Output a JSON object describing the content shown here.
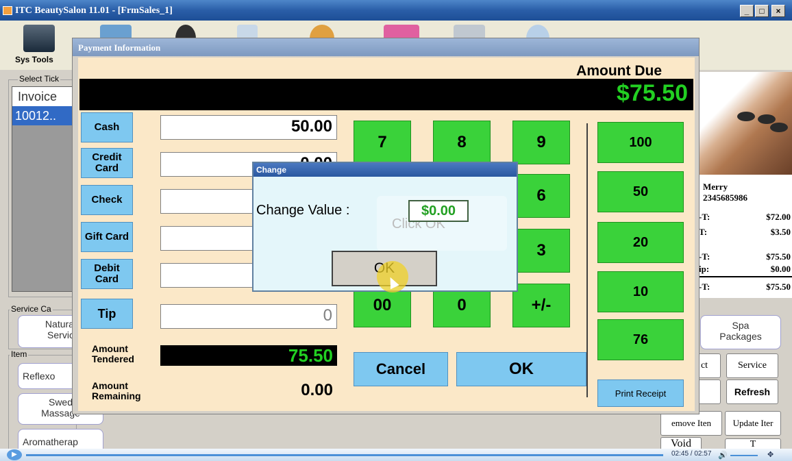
{
  "window": {
    "title": "ITC BeautySalon 11.01 - [FrmSales_1]",
    "buttons": [
      "_",
      "□",
      "×"
    ]
  },
  "toolbar": {
    "sys_tools_label": "Sys Tools"
  },
  "left_panel": {
    "select_ticket_label": "Select Tick",
    "invoice_header": "Invoice",
    "invoice_row": "10012..",
    "service_category_label": "Service Ca",
    "service_category_button": "Natural\nServic",
    "item_label": "Item",
    "items": [
      "Reflexo",
      "Swed\nMassage",
      "Aromatherap"
    ]
  },
  "right_panel": {
    "customer_name": "Merry",
    "customer_phone": "2345685986",
    "summary": [
      {
        "label": "-T:",
        "value": "$72.00"
      },
      {
        "label": "T:",
        "value": "$3.50"
      },
      {
        "label": "-T:",
        "value": "$75.50"
      },
      {
        "label": "ip:",
        "value": "$0.00"
      },
      {
        "label": "-T:",
        "value": "$75.50"
      }
    ],
    "spa_packages": "Spa\nPackages",
    "buttons": {
      "product": "ct",
      "service": "Service",
      "refresh": "Refresh",
      "remove_item": "emove Iten",
      "update_item": "Update Iter",
      "void": "Void",
      "extra": "T"
    }
  },
  "payment_dialog": {
    "title": "Payment Information",
    "amount_due_label": "Amount Due",
    "amount_due_value": "$75.50",
    "methods": [
      {
        "label": "Cash",
        "value": "50.00"
      },
      {
        "label": "Credit\nCard",
        "value": "0.00"
      },
      {
        "label": "Check",
        "value": ""
      },
      {
        "label": "Gift Card",
        "value": ""
      },
      {
        "label": "Debit\nCard",
        "value": ""
      },
      {
        "label": "Tip",
        "value": "0"
      }
    ],
    "amount_tendered_label": "Amount\nTendered",
    "amount_tendered_value": "75.50",
    "amount_remaining_label": "Amount\nRemaining",
    "amount_remaining_value": "0.00",
    "keypad": [
      "7",
      "8",
      "9",
      "6",
      "3",
      "00",
      "0",
      "+/-"
    ],
    "quick_amounts": [
      "100",
      "50",
      "20",
      "10",
      "76"
    ],
    "cancel_label": "Cancel",
    "ok_label": "OK",
    "print_receipt_label": "Print Receipt"
  },
  "change_dialog": {
    "title": "Change",
    "change_label": "Change Value :",
    "change_value": "$0.00",
    "hint": "Click OK",
    "ok_label": "OK"
  },
  "video": {
    "time": "02:45 / 02:57"
  },
  "colors": {
    "green_button": "#3ad23a",
    "blue_button": "#7ec8f0",
    "due_text": "#22d022",
    "dialog_bg": "#fbe8c8"
  }
}
